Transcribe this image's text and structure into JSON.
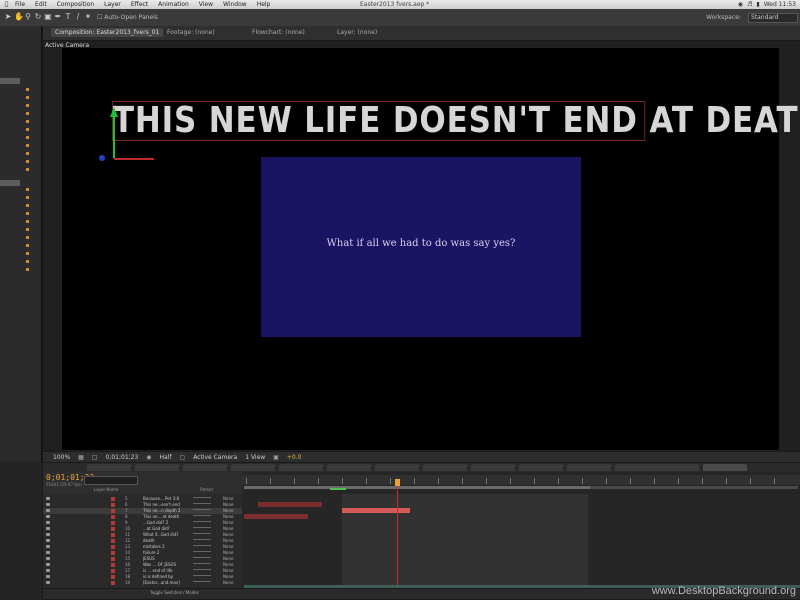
{
  "menubar": {
    "items": [
      "File",
      "Edit",
      "Composition",
      "Layer",
      "Effect",
      "Animation",
      "View",
      "Window",
      "Help"
    ],
    "title": "Easter2013 fvers.aep *",
    "clock": "Wed 11:53"
  },
  "toolbar": {
    "auto_open": "Auto-Open Panels",
    "workspace_label": "Workspace:",
    "workspace_value": "Standard"
  },
  "composition": {
    "tabs": [
      "Composition: Easter2013_fvers_01",
      "Footage: (none)",
      "Flowchart: (none)",
      "Layer: (none)"
    ],
    "active_camera": "Active Camera",
    "headline": "THIS NEW LIFE DOESN'T END AT DEATH",
    "subtitle": "What if all we had to do was say yes?"
  },
  "viewer_footer": {
    "zoom": "100%",
    "timecode": "0;01;01;23",
    "resolution": "Half",
    "camera": "Active Camera",
    "views": "1 View",
    "offset": "+0.0"
  },
  "timeline": {
    "timecode": "0;01;01;23",
    "fps": "01843 (29.97 fps)",
    "col_source": "Layer Name",
    "col_parent": "Parent",
    "layers": [
      {
        "idx": "5",
        "name": "Because... Pet 3:8",
        "parent": "None"
      },
      {
        "idx": "6",
        "name": "This ne...esn't end",
        "parent": "None"
      },
      {
        "idx": "7",
        "name": "This ne...n depth 2",
        "parent": "None"
      },
      {
        "idx": "8",
        "name": "This ne... at death",
        "parent": "None"
      },
      {
        "idx": "9",
        "name": "...God did? 2",
        "parent": "None"
      },
      {
        "idx": "10",
        "name": "...at God did?",
        "parent": "None"
      },
      {
        "idx": "11",
        "name": "What if...God did?",
        "parent": "None"
      },
      {
        "idx": "12",
        "name": "death",
        "parent": "None"
      },
      {
        "idx": "13",
        "name": "mistakes 2",
        "parent": "None"
      },
      {
        "idx": "14",
        "name": "failure 2",
        "parent": "None"
      },
      {
        "idx": "15",
        "name": "JESUS",
        "parent": "None"
      },
      {
        "idx": "16",
        "name": "Was ... OF JESUS",
        "parent": "None"
      },
      {
        "idx": "17",
        "name": "is ... end of life",
        "parent": "None"
      },
      {
        "idx": "18",
        "name": "is is defined by",
        "parent": "None"
      },
      {
        "idx": "19",
        "name": "[Easter...and.mov]",
        "parent": "None"
      }
    ],
    "toggle": "Toggle Switches / Modes"
  },
  "watermark": "www.DesktopBackground.org"
}
